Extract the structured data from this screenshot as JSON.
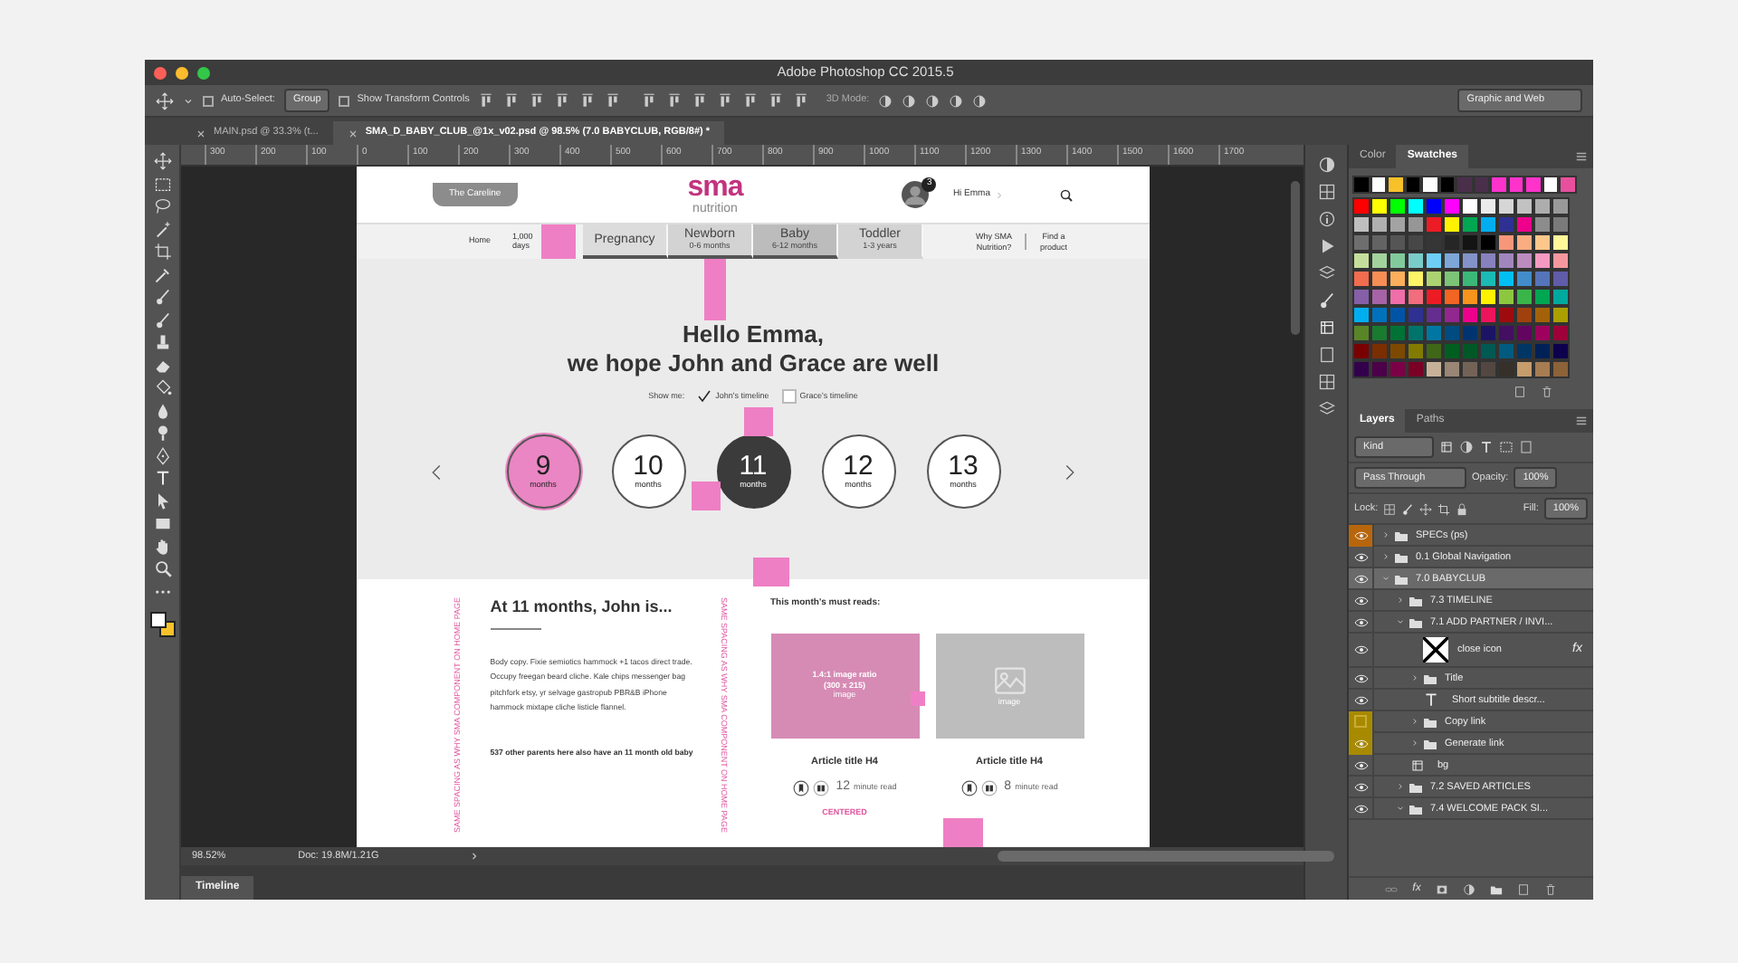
{
  "window": {
    "title": "Adobe Photoshop CC 2015.5"
  },
  "options_bar": {
    "auto_select": {
      "label": "Auto-Select:",
      "checked": false
    },
    "target": "Group",
    "transform": {
      "label": "Show Transform Controls",
      "checked": false
    },
    "mode_label": "3D Mode:",
    "workspace": "Graphic and Web"
  },
  "document_tabs": [
    {
      "label": "MAIN.psd @ 33.3% (t...",
      "selected": false
    },
    {
      "label": "SMA_D_BABY_CLUB_@1x_v02.psd @ 98.5% (7.0  BABYCLUB, RGB/8#) *",
      "selected": true
    }
  ],
  "ruler": [
    "300",
    "200",
    "100",
    "0",
    "100",
    "200",
    "300",
    "400",
    "500",
    "600",
    "700",
    "800",
    "900",
    "1000",
    "1100",
    "1200",
    "1300",
    "1400",
    "1500",
    "1600",
    "1700"
  ],
  "design": {
    "header": {
      "careline": "The Careline",
      "logo_top": "sma",
      "logo_bottom": "nutrition",
      "notification_count": "3",
      "greeting": "Hi Emma"
    },
    "nav": {
      "home": "Home",
      "days": "1,000 days",
      "stages": [
        {
          "label": "Pregnancy",
          "selected": false
        },
        {
          "label": "Newborn",
          "sub": "0-6 months",
          "selected": false
        },
        {
          "label": "Baby",
          "sub": "6-12 months",
          "selected": true
        },
        {
          "label": "Toddler",
          "sub": "1-3 years",
          "selected": false
        }
      ],
      "why": "Why SMA Nutrition?",
      "find": "Find a product"
    },
    "hero": {
      "title_lines": [
        "Hello Emma,",
        "we hope John and Grace are well"
      ],
      "show_me": "Show me:",
      "timelines": [
        {
          "label": "John's timeline",
          "checked": true
        },
        {
          "label": "Grace's timeline",
          "checked": false
        }
      ],
      "months": [
        {
          "number": "9",
          "unit": "months",
          "selected": false,
          "highlighted": true
        },
        {
          "number": "10",
          "unit": "months",
          "selected": false,
          "highlighted": false
        },
        {
          "number": "11",
          "unit": "months",
          "selected": true,
          "highlighted": false
        },
        {
          "number": "12",
          "unit": "months",
          "selected": false,
          "highlighted": false
        },
        {
          "number": "13",
          "unit": "months",
          "selected": false,
          "highlighted": false
        }
      ]
    },
    "article": {
      "side_note_left": "SAME SPACING AS WHY SMA COMPONENT ON HOME PAGE",
      "heading": "At 11 months, John is...",
      "body": "Body copy. Fixie semiotics hammock +1 tacos direct trade. Occupy freegan beard cliche. Kale chips messenger bag pitchfork etsy, yr selvage gastropub PBR&B iPhone hammock mixtape cliche listicle flannel.",
      "parents_note": "537 other parents here also have an 11 month old baby",
      "side_note_right": "SAME SPACING AS WHY SMA COMPONENT ON HOME PAGE"
    },
    "reads": {
      "title": "This month's must reads:",
      "cards": [
        {
          "kind": "annotated",
          "image_lines": [
            "1.4:1 image ratio",
            "(300 x 215)"
          ],
          "image_label": "image",
          "title": "Article title H4",
          "minutes": "12",
          "minutes_label": "minute read",
          "note": "CENTERED"
        },
        {
          "kind": "plain",
          "image_label": "image",
          "title": "Article title H4",
          "minutes": "8",
          "minutes_label": "minute read"
        }
      ]
    }
  },
  "status_bar": {
    "zoom": "98.52%",
    "doc": "Doc: 19.8M/1.21G"
  },
  "timeline_panel": {
    "label": "Timeline"
  },
  "panels": {
    "color_tabs": [
      {
        "label": "Color",
        "selected": false
      },
      {
        "label": "Swatches",
        "selected": true
      }
    ],
    "recent_swatches": [
      {
        "color": "#000000"
      },
      {
        "color": "#ffffff"
      },
      {
        "color": "#f7c12a"
      },
      {
        "color": "#000000"
      },
      {
        "color": "#ffffff"
      },
      {
        "color": "#000000"
      },
      {
        "color": "#4a2f4a"
      },
      {
        "color": "#4a2f4a"
      },
      {
        "color": "#ff33cc"
      },
      {
        "color": "#ff33cc"
      },
      {
        "color": "#ff33cc"
      },
      {
        "color": "#ffffff"
      },
      {
        "color": "#e8509e"
      }
    ],
    "swatches": [
      {
        "color": "#ff0000"
      },
      {
        "color": "#ffff00"
      },
      {
        "color": "#00ff00"
      },
      {
        "color": "#00ffff"
      },
      {
        "color": "#0000ff"
      },
      {
        "color": "#ff00ff"
      },
      {
        "color": "#ffffff"
      },
      {
        "color": "#ebebeb"
      },
      {
        "color": "#d6d6d6"
      },
      {
        "color": "#c2c2c2"
      },
      {
        "color": "#adadad"
      },
      {
        "color": "#999999"
      },
      {
        "color": "#bfbfbf"
      },
      {
        "color": "#b0b0b0"
      },
      {
        "color": "#a3a3a3"
      },
      {
        "color": "#969696"
      },
      {
        "color": "#ed1c24"
      },
      {
        "color": "#fff200"
      },
      {
        "color": "#00a651"
      },
      {
        "color": "#00aeef"
      },
      {
        "color": "#2e3192"
      },
      {
        "color": "#ec008c"
      },
      {
        "color": "#8c8c8c"
      },
      {
        "color": "#7a7a7a"
      },
      {
        "color": "#6e6e6e"
      },
      {
        "color": "#636363"
      },
      {
        "color": "#555555"
      },
      {
        "color": "#474747"
      },
      {
        "color": "#363636"
      },
      {
        "color": "#262626"
      },
      {
        "color": "#141414"
      },
      {
        "color": "#000000"
      },
      {
        "color": "#f7977a"
      },
      {
        "color": "#f9ad81"
      },
      {
        "color": "#fdc68a"
      },
      {
        "color": "#fff799"
      },
      {
        "color": "#c4df9b"
      },
      {
        "color": "#a3d39c"
      },
      {
        "color": "#82ca9c"
      },
      {
        "color": "#7accc8"
      },
      {
        "color": "#6dcff6"
      },
      {
        "color": "#7da7d9"
      },
      {
        "color": "#8393ca"
      },
      {
        "color": "#8781bd"
      },
      {
        "color": "#a186be"
      },
      {
        "color": "#bd8cbf"
      },
      {
        "color": "#f49ac1"
      },
      {
        "color": "#f5989d"
      },
      {
        "color": "#f26c4f"
      },
      {
        "color": "#f68e55"
      },
      {
        "color": "#fbaf5c"
      },
      {
        "color": "#fff467"
      },
      {
        "color": "#acd372"
      },
      {
        "color": "#7cc576"
      },
      {
        "color": "#3bb878"
      },
      {
        "color": "#1abbb4"
      },
      {
        "color": "#00bff3"
      },
      {
        "color": "#438ccb"
      },
      {
        "color": "#5574b9"
      },
      {
        "color": "#605ca8"
      },
      {
        "color": "#855fa8"
      },
      {
        "color": "#a763a8"
      },
      {
        "color": "#f06eaa"
      },
      {
        "color": "#f26d7d"
      },
      {
        "color": "#ed1c24"
      },
      {
        "color": "#f26522"
      },
      {
        "color": "#f7941d"
      },
      {
        "color": "#fff200"
      },
      {
        "color": "#8dc73f"
      },
      {
        "color": "#39b54a"
      },
      {
        "color": "#00a651"
      },
      {
        "color": "#00a99d"
      },
      {
        "color": "#00aeef"
      },
      {
        "color": "#0072bc"
      },
      {
        "color": "#0054a6"
      },
      {
        "color": "#2e3192"
      },
      {
        "color": "#662d91"
      },
      {
        "color": "#92278f"
      },
      {
        "color": "#ec008c"
      },
      {
        "color": "#ed145b"
      },
      {
        "color": "#9e0b0f"
      },
      {
        "color": "#a0410d"
      },
      {
        "color": "#a36209"
      },
      {
        "color": "#aba000"
      },
      {
        "color": "#598527"
      },
      {
        "color": "#197b30"
      },
      {
        "color": "#007236"
      },
      {
        "color": "#00746b"
      },
      {
        "color": "#0076a3"
      },
      {
        "color": "#004b80"
      },
      {
        "color": "#003471"
      },
      {
        "color": "#1b1464"
      },
      {
        "color": "#440e62"
      },
      {
        "color": "#630460"
      },
      {
        "color": "#9e005d"
      },
      {
        "color": "#9e0039"
      },
      {
        "color": "#790000"
      },
      {
        "color": "#7b2e00"
      },
      {
        "color": "#7d4900"
      },
      {
        "color": "#827b00"
      },
      {
        "color": "#406618"
      },
      {
        "color": "#005e20"
      },
      {
        "color": "#005826"
      },
      {
        "color": "#005952"
      },
      {
        "color": "#005b7f"
      },
      {
        "color": "#003663"
      },
      {
        "color": "#002157"
      },
      {
        "color": "#0d004c"
      },
      {
        "color": "#32004b"
      },
      {
        "color": "#4b0049"
      },
      {
        "color": "#7b0046"
      },
      {
        "color": "#7a0026"
      },
      {
        "color": "#c7b299"
      },
      {
        "color": "#998675"
      },
      {
        "color": "#736357"
      },
      {
        "color": "#534741"
      },
      {
        "color": "#37302a"
      },
      {
        "color": "#c69c6d"
      },
      {
        "color": "#a67c52"
      },
      {
        "color": "#8c6239"
      }
    ],
    "layer_tabs": [
      {
        "label": "Layers",
        "selected": true
      },
      {
        "label": "Paths",
        "selected": false
      }
    ],
    "filter": "Kind",
    "blend_mode": "Pass Through",
    "opacity_label": "Opacity:",
    "opacity": "100%",
    "lock_label": "Lock:",
    "fill_label": "Fill:",
    "fill": "100%",
    "layers": [
      {
        "kind": "folder",
        "name": "SPECs (ps)",
        "visible": true,
        "color": "#b8660b",
        "expanded": false,
        "selected": false
      },
      {
        "kind": "folder",
        "name": "0.1 Global Navigation",
        "visible": true,
        "expanded": false,
        "selected": false
      },
      {
        "kind": "folder",
        "name": "7.0  BABYCLUB",
        "visible": true,
        "expanded": true,
        "selected": true,
        "children": [
          {
            "kind": "folder",
            "name": "7.3 TIMELINE",
            "visible": true,
            "expanded": false,
            "selected": false
          },
          {
            "kind": "folder",
            "name": "7.1 ADD PARTNER / INVI...",
            "visible": true,
            "expanded": true,
            "selected": false,
            "children": [
              {
                "kind": "smart",
                "name": "close icon",
                "effects": "fx",
                "visible": true,
                "selected": false
              },
              {
                "kind": "folder",
                "name": "Title",
                "visible": true,
                "expanded": false,
                "selected": false
              },
              {
                "kind": "text",
                "name": "Short subtitle descr...",
                "visible": true,
                "selected": false
              },
              {
                "kind": "folder",
                "name": "Copy link",
                "visible": false,
                "color": "#a88a00",
                "expanded": false,
                "selected": false
              },
              {
                "kind": "folder",
                "name": "Generate link",
                "visible": true,
                "color": "#a88a00",
                "expanded": false,
                "selected": false
              },
              {
                "kind": "frame",
                "name": "bg",
                "visible": true,
                "selected": false
              }
            ]
          },
          {
            "kind": "folder",
            "name": "7.2 SAVED ARTICLES",
            "visible": true,
            "expanded": false,
            "selected": false
          },
          {
            "kind": "folder",
            "name": "7.4 WELCOME PACK SI...",
            "visible": true,
            "expanded": true,
            "selected": false
          }
        ]
      }
    ],
    "footer_fx": "fx"
  }
}
